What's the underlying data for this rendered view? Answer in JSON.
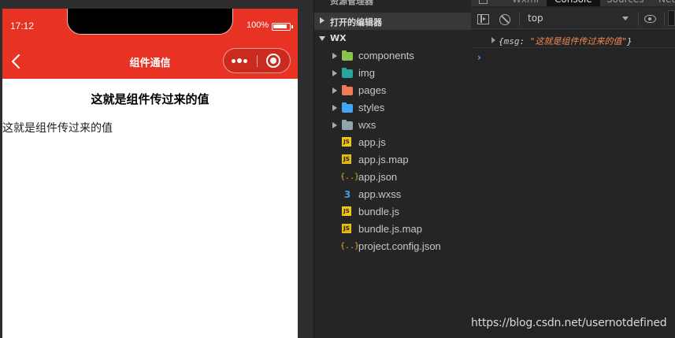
{
  "simulator": {
    "status_time": "17:12",
    "battery_percent": "100%",
    "nav_title": "组件通信",
    "heading": "这就是组件传过来的值",
    "body_text": "这就是组件传过来的值",
    "header_color": "#e83223"
  },
  "explorer": {
    "clipped_title": "资源管理器",
    "open_editors_label": "打开的编辑器",
    "root_label": "WX",
    "items": [
      {
        "label": "components",
        "type": "folder",
        "icon": "folder-components-icon",
        "color": "#8bc34a"
      },
      {
        "label": "img",
        "type": "folder",
        "icon": "folder-img-icon",
        "color": "#26a69a"
      },
      {
        "label": "pages",
        "type": "folder",
        "icon": "folder-pages-icon",
        "color": "#ef7a54"
      },
      {
        "label": "styles",
        "type": "folder",
        "icon": "folder-styles-icon",
        "color": "#42a5f5"
      },
      {
        "label": "wxs",
        "type": "folder",
        "icon": "folder-icon",
        "color": "#90a4ae"
      },
      {
        "label": "app.js",
        "type": "js",
        "icon": "js-file-icon",
        "glyph": "JS"
      },
      {
        "label": "app.js.map",
        "type": "jsmap",
        "icon": "js-map-file-icon",
        "glyph": "JS"
      },
      {
        "label": "app.json",
        "type": "json",
        "icon": "json-file-icon",
        "glyph": "{..}"
      },
      {
        "label": "app.wxss",
        "type": "css",
        "icon": "css-file-icon",
        "glyph": "3"
      },
      {
        "label": "bundle.js",
        "type": "js",
        "icon": "js-file-icon",
        "glyph": "JS"
      },
      {
        "label": "bundle.js.map",
        "type": "jsmap",
        "icon": "js-map-file-icon",
        "glyph": "JS"
      },
      {
        "label": "project.config.json",
        "type": "json",
        "icon": "json-file-icon",
        "glyph": "{..}"
      }
    ]
  },
  "devtools": {
    "tabs": [
      "Wxml",
      "Console",
      "Sources",
      "Net"
    ],
    "active_tab": "Console",
    "context_value": "top",
    "log": {
      "open_brace": "{",
      "key": "msg",
      "colon": ": ",
      "value": "\"这就是组件传过来的值\"",
      "close_brace": "}"
    },
    "prompt_symbol": "›"
  },
  "watermark": "https://blog.csdn.net/usernotdefined"
}
